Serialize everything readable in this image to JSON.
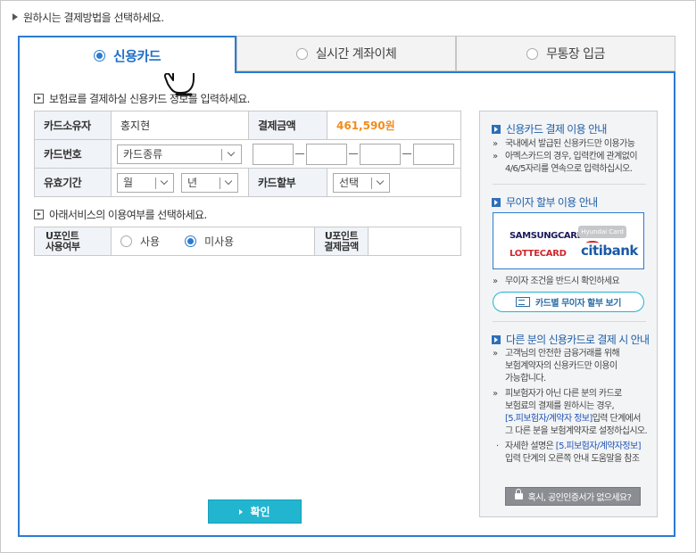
{
  "page": {
    "heading": "원하시는 결제방법을 선택하세요."
  },
  "tabs": [
    {
      "label": "신용카드",
      "selected": true
    },
    {
      "label": "실시간 계좌이체",
      "selected": false
    },
    {
      "label": "무통장 입금",
      "selected": false
    }
  ],
  "card_section": {
    "title": "보험료를 결제하실 신용카드 정보를 입력하세요.",
    "holder_label": "카드소유자",
    "holder_value": "홍지현",
    "amount_label": "결제금액",
    "amount_value": "461,590원",
    "card_number_label": "카드번호",
    "card_type_value": "카드종류",
    "expiry_label": "유효기간",
    "month_value": "월",
    "year_value": "년",
    "installment_label": "카드할부",
    "installment_value": "선택"
  },
  "service_section": {
    "title": "아래서비스의 이용여부를 선택하세요.",
    "upoint_label_1": "U포인트",
    "upoint_label_2": "사용여부",
    "option_use": "사용",
    "option_nouse": "미사용",
    "selected": "미사용",
    "upoint_amount_label_1": "U포인트",
    "upoint_amount_label_2": "결제금액"
  },
  "confirm_button": {
    "label": "확인"
  },
  "side": {
    "guide_title": "신용카드 결제 이용 안내",
    "guide_items": [
      "국내에서 발급된 신용카드만 이용가능",
      "아멕스카드의 경우, 입력칸에 관계없이",
      "4/6/5자리를 연속으로 입력하십시오."
    ],
    "interest_title": "무이자 할부 이용 안내",
    "cards": {
      "samsung": "SAMSUNGCARD",
      "hyundai": "Hyundai Card",
      "lotte": "LOTTECARD",
      "citi": "citibank"
    },
    "interest_note": "무이자 조건을 반드시 확인하세요",
    "interest_button": "카드별 무이자 할부 보기",
    "other_title": "다른 분의 신용카드로 결제 시 안내",
    "other_lines": [
      "고객님의 안전한 금융거래를 위해",
      "보험계약자의 신용카드만 이용이",
      "가능합니다.",
      "피보험자가 아닌 다른 분의 카드로",
      "보험료의 결제를 원하시는 경우,",
      "[5.피보험자/계약자 정보]",
      "입력 단계에서",
      "그 다른 분을 보험계약자로 설정하십시오.",
      "자세한 설명은",
      "[5.피보험자/계약자정보]",
      "입력 단계의 오른쪽 안내 도움말을 참조"
    ],
    "cert_button": "혹시, 공인인증서가 없으세요?"
  },
  "colors": {
    "accent": "#2b7bd0",
    "button": "#22b5cf",
    "amount": "#f28c1c"
  }
}
